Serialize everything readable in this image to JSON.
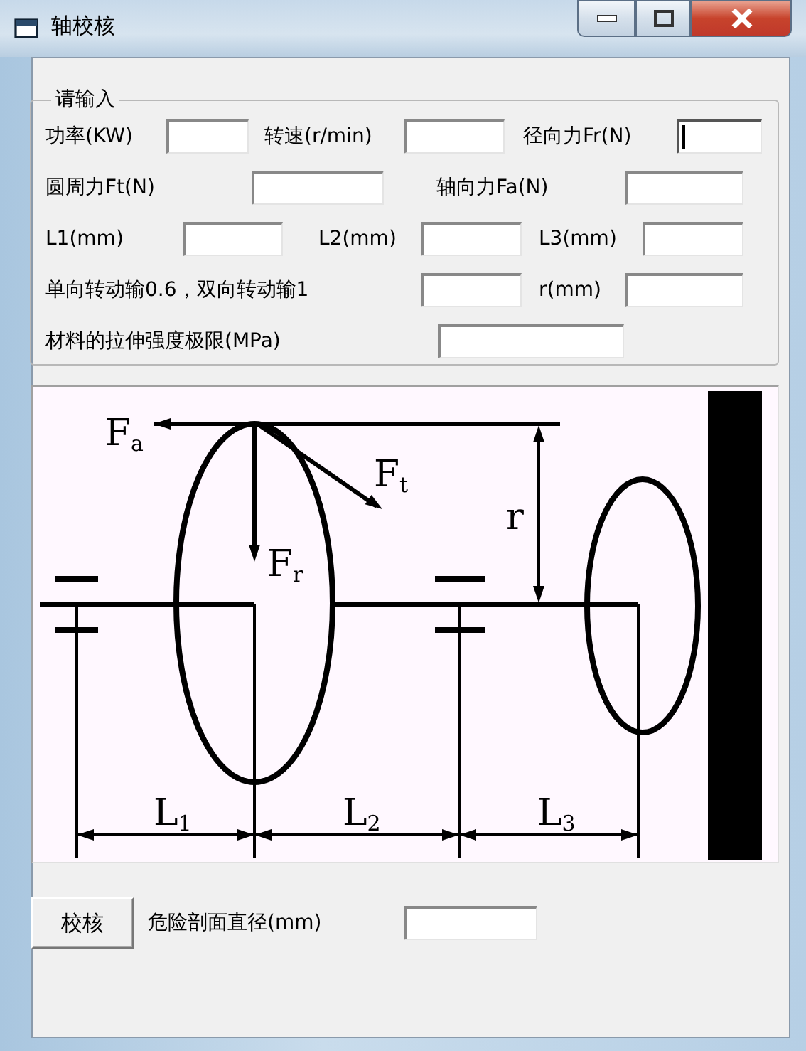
{
  "window": {
    "title": "轴校核"
  },
  "input_group": {
    "title": "请输入",
    "rows": [
      [
        {
          "label": "功率(KW)",
          "focused": false
        },
        {
          "label": "转速(r/min)",
          "focused": false
        },
        {
          "label": "径向力Fr(N)",
          "focused": true
        }
      ],
      [
        {
          "label": "圆周力Ft(N)",
          "focused": false
        },
        {
          "label": "轴向力Fa(N)",
          "focused": false
        }
      ],
      [
        {
          "label": "L1(mm)",
          "focused": false
        },
        {
          "label": "L2(mm)",
          "focused": false
        },
        {
          "label": "L3(mm)",
          "focused": false
        }
      ],
      [
        {
          "label": "单向转动输0.6，双向转动输1",
          "focused": false
        },
        {
          "label": "r(mm)",
          "focused": false
        }
      ],
      [
        {
          "label": "材料的拉伸强度极限(MPa)",
          "focused": false
        }
      ]
    ]
  },
  "diagram": {
    "labels": [
      {
        "symbol": "F",
        "subscript": "a"
      },
      {
        "symbol": "F",
        "subscript": "t"
      },
      {
        "symbol": "F",
        "subscript": "r"
      },
      {
        "symbol": "r"
      },
      {
        "symbol": "L",
        "subscript": "1"
      },
      {
        "symbol": "L",
        "subscript": "2"
      },
      {
        "symbol": "L",
        "subscript": "3"
      }
    ]
  },
  "check_button": "校核",
  "result": {
    "label": "危险剖面直径(mm)",
    "focused": false
  }
}
